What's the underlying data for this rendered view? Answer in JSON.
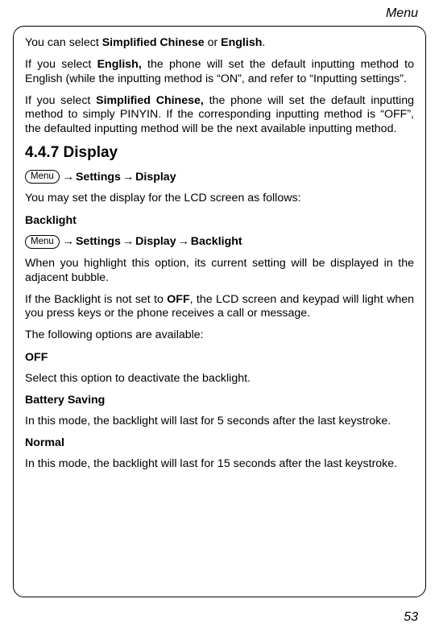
{
  "header": {
    "section": "Menu"
  },
  "intro": {
    "p1_pre": "You can select ",
    "p1_b1": "Simplified Chinese",
    "p1_mid": " or ",
    "p1_b2": "English",
    "p1_post": ".",
    "p2_pre": "If you select ",
    "p2_b": "English,",
    "p2_post": " the phone will set the default inputting method to English (while the inputting method is “ON”, and refer to “Inputting settings”.",
    "p3_pre": "If you select ",
    "p3_b": "Simplified Chinese,",
    "p3_post": " the phone will set the default inputting method to simply PINYIN. If the corresponding inputting method is “OFF”, the defaulted inputting method will be the next available inputting method."
  },
  "section447": {
    "heading": "4.4.7 Display",
    "nav1": {
      "menu": "Menu",
      "arrow": "→",
      "seg1": "Settings",
      "seg2": "Display"
    },
    "p1": "You may set the display for the LCD screen as follows:",
    "backlight": {
      "title": "Backlight",
      "nav": {
        "menu": "Menu",
        "arrow": "→",
        "seg1": "Settings",
        "seg2": "Display",
        "seg3": "Backlight"
      },
      "p1": "When you highlight this option, its current setting will be displayed in the adjacent bubble.",
      "p2_pre": "If the Backlight is not set to ",
      "p2_b": "OFF",
      "p2_post": ", the LCD screen and keypad will light when you press keys or the phone receives a call or message.",
      "p3": "The following options are available:",
      "opt_off_title": "OFF",
      "opt_off_desc": "Select this option to deactivate the backlight.",
      "opt_bs_title": "Battery Saving",
      "opt_bs_desc": "In this mode, the backlight will last for 5 seconds after the last keystroke.",
      "opt_norm_title": "Normal",
      "opt_norm_desc": "In this mode, the backlight will last for 15 seconds after the last keystroke."
    }
  },
  "footer": {
    "pagenum": "53"
  }
}
